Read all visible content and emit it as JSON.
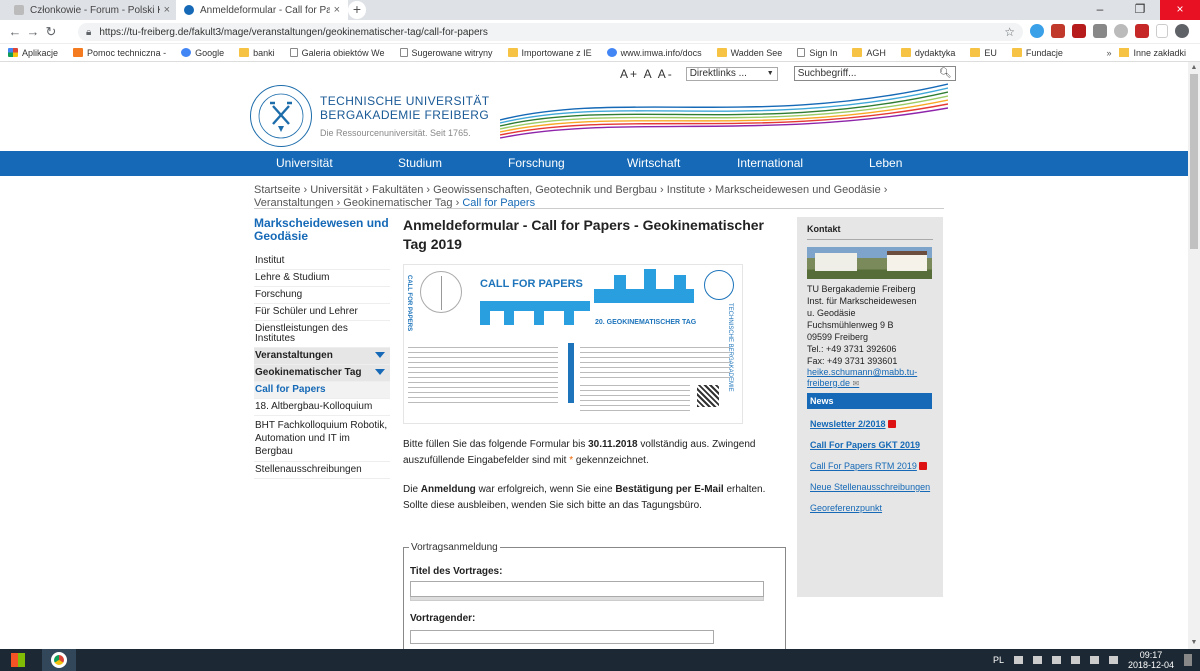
{
  "browser": {
    "tabs": [
      {
        "title": "Członkowie - Forum - Polski Kon",
        "active": false
      },
      {
        "title": "Anmeldeformular - Call for Paper",
        "active": true
      }
    ],
    "new_tab": "+",
    "url": "https://tu-freiberg.de/fakult3/mage/veranstaltungen/geokinematischer-tag/call-for-papers",
    "bookmarks": [
      {
        "label": "Aplikacje",
        "icon": "apps-icon"
      },
      {
        "label": "Pomoc techniczna - ",
        "icon": "e-icon"
      },
      {
        "label": "Google",
        "icon": "google-icon"
      },
      {
        "label": "banki",
        "icon": "folder-icon"
      },
      {
        "label": "Galeria obiektów We",
        "icon": "page-icon"
      },
      {
        "label": "Sugerowane witryny",
        "icon": "page-icon"
      },
      {
        "label": "Importowane z IE",
        "icon": "folder-icon"
      },
      {
        "label": "www.imwa.info/docs",
        "icon": "globe-icon"
      },
      {
        "label": "Wadden See",
        "icon": "folder-icon"
      },
      {
        "label": "Sign In",
        "icon": "page-icon"
      },
      {
        "label": "AGH",
        "icon": "folder-icon"
      },
      {
        "label": "dydaktyka",
        "icon": "folder-icon"
      },
      {
        "label": "EU",
        "icon": "folder-icon"
      },
      {
        "label": "Fundacje",
        "icon": "folder-icon"
      }
    ],
    "bookmarks_more": "»",
    "other_bookmarks": "Inne zakładki"
  },
  "page": {
    "fontsize_label": "A+ A A-",
    "direktlinks": "Direktlinks ...",
    "search_placeholder": "Suchbegriff...",
    "logo": {
      "line1": "TECHNISCHE UNIVERSITÄT",
      "line2": "BERGAKADEMIE FREIBERG",
      "tagline": "Die Ressourcenuniversität. Seit 1765.",
      "seal_text": "TU BERGAKADEMIE FREIBERG"
    },
    "nav": [
      "Universität",
      "Studium",
      "Forschung",
      "Wirtschaft",
      "International",
      "Leben"
    ],
    "breadcrumb": {
      "path": "Startseite › Universität › Fakultäten › Geowissenschaften, Geotechnik und Bergbau › Institute › Markscheidewesen und Geodäsie › Veranstaltungen › Geokinematischer Tag ›",
      "current": "Call for Papers"
    },
    "sidenav": {
      "title": "Markscheidewesen und Geodäsie",
      "items": [
        {
          "label": "Institut",
          "type": "plain"
        },
        {
          "label": "Lehre & Studium",
          "type": "plain"
        },
        {
          "label": "Forschung",
          "type": "plain"
        },
        {
          "label": "Für Schüler und Lehrer",
          "type": "plain"
        },
        {
          "label": "Dienstleistungen des Institutes",
          "type": "plain"
        },
        {
          "label": "Veranstaltungen",
          "type": "gray"
        },
        {
          "label": "Geokinematischer Tag",
          "type": "gray"
        },
        {
          "label": "Call for Papers",
          "type": "active"
        },
        {
          "label": "18. Altbergbau-Kolloquium",
          "type": "plain"
        },
        {
          "label": "BHT Fachkolloquium Robotik, Automation und IT im Bergbau",
          "type": "multi"
        },
        {
          "label": "Stellenausschreibungen",
          "type": "plain"
        }
      ]
    },
    "content": {
      "heading": "Anmeldeformular - Call for Papers - Geokinematischer Tag 2019",
      "poster": {
        "cfp": "CALL FOR PAPERS",
        "gkt": "20. GEOKINEMATISCHER TAG",
        "vert_left": "CALL FOR PAPERS",
        "vert_right": "TECHNISCHE BERGAKADEMIE"
      },
      "para1_a": "Bitte füllen Sie das folgende Formular bis ",
      "para1_date": "30.11.2018",
      "para1_b": " vollständig aus. Zwingend auszufüllende Eingabefelder sind mit ",
      "para1_star": "*",
      "para1_c": " gekennzeichnet.",
      "para2_a": "Die ",
      "para2_b": "Anmeldung",
      "para2_c": " war erfolgreich, wenn Sie eine ",
      "para2_d": "Bestätigung per E-Mail",
      "para2_e": " erhalten. Sollte diese ausbleiben, wenden Sie sich bitte an das Tagungsbüro.",
      "legend": "Vortragsanmeldung",
      "field1": "Titel des Vortrages:",
      "field2": "Vortragender:"
    },
    "right": {
      "title": "Kontakt",
      "address": [
        "TU Bergakademie Freiberg",
        "Inst. für Markscheidewesen",
        "u. Geodäsie",
        "Fuchsmühlenweg 9 B",
        "09599 Freiberg",
        "Tel.: +49 3731 392606",
        "Fax: +49 3731 393601"
      ],
      "email": "heike.schumann@mabb.tu-freiberg.de",
      "news": "News",
      "links": [
        {
          "label": "Newsletter 2/2018",
          "bold": true,
          "pdf": true
        },
        {
          "label": "Call For Papers GKT 2019",
          "bold": true,
          "pdf": false
        },
        {
          "label": "Call For Papers RTM 2019",
          "bold": false,
          "pdf": true
        },
        {
          "label": "Neue Stellenausschreibungen",
          "bold": false,
          "pdf": false
        },
        {
          "label": "Georeferenzpunkt",
          "bold": false,
          "pdf": false
        }
      ]
    }
  },
  "taskbar": {
    "lang": "PL",
    "time": "09:17",
    "date": "2018-12-04"
  },
  "colors": {
    "brand_blue": "#1569b6",
    "close_red": "#e81123"
  }
}
